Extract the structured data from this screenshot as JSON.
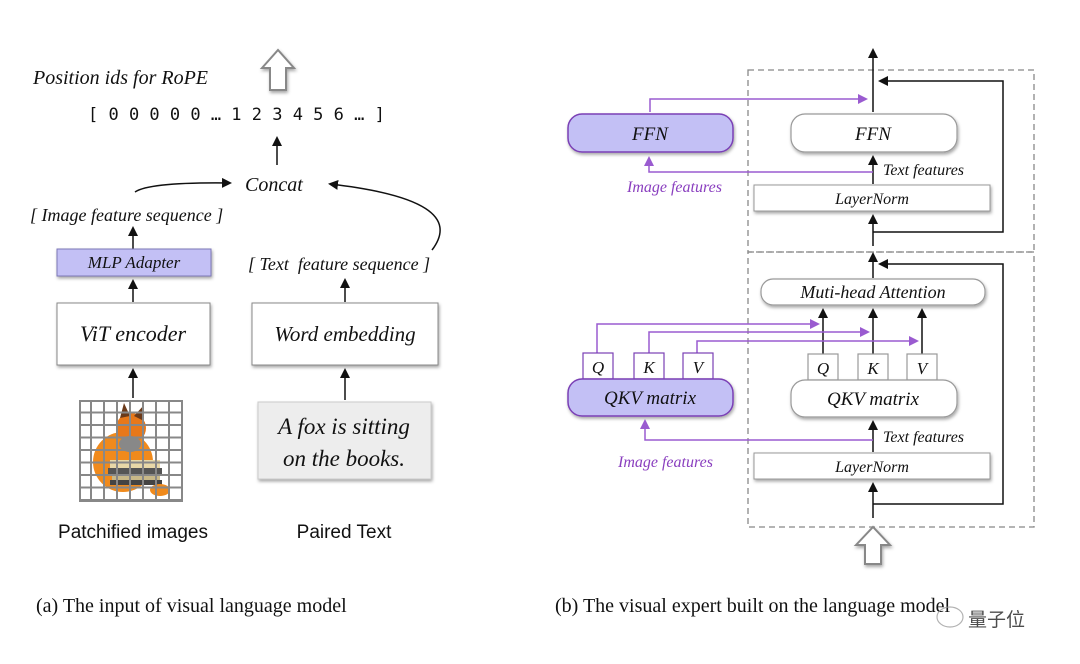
{
  "panel_a": {
    "rope_label": "Position ids for RoPE",
    "position_ids": "[ 0 0 0 0 0 … 1 2 3 4 5 6 … ]",
    "concat": "Concat",
    "image_feature_sequence": "[ Image feature sequence ]",
    "text_feature_sequence": "[ Text  feature sequence ]",
    "mlp_adapter": "MLP Adapter",
    "vit_encoder": "ViT encoder",
    "word_embedding": "Word embedding",
    "paired_text_line1": "A fox is sitting",
    "paired_text_line2": "on the books.",
    "patchified_label": "Patchified images",
    "paired_label": "Paired Text",
    "caption": "(a) The input of visual language model"
  },
  "panel_b": {
    "ffn_image": "FFN",
    "ffn_text": "FFN",
    "text_features_top": "Text features",
    "image_features_top": "Image features",
    "layernorm_top": "LayerNorm",
    "attention": "Muti-head Attention",
    "q_image": "Q",
    "k_image": "K",
    "v_image": "V",
    "q_text": "Q",
    "k_text": "K",
    "v_text": "V",
    "qkv_image": "QKV matrix",
    "qkv_text": "QKV matrix",
    "text_features_bottom": "Text features",
    "image_features_bottom": "Image features",
    "layernorm_bottom": "LayerNorm",
    "caption": "(b) The visual expert built on the language model"
  },
  "watermark": "量子位",
  "colors": {
    "expert_fill": "#c3c0f5",
    "expert_border": "#7a3fb5",
    "image_path": "#9a5bd0",
    "text_path": "#111111"
  }
}
